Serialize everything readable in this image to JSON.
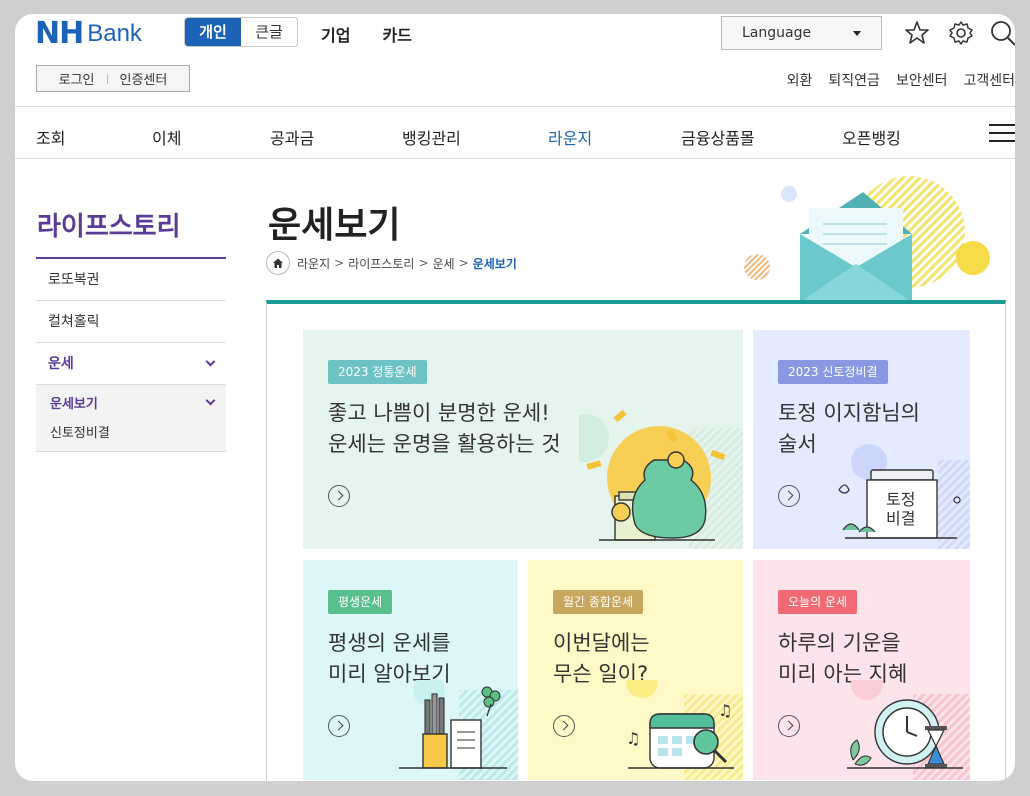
{
  "header": {
    "logo_primary": "NH",
    "logo_secondary": "Bank",
    "segments": [
      "개인",
      "큰글"
    ],
    "top_nav": [
      "기업",
      "카드"
    ],
    "language_label": "Language",
    "login": "로그인",
    "certificate": "인증센터",
    "utility_links": [
      "외환",
      "퇴직연금",
      "보안센터",
      "고객센터"
    ]
  },
  "gnb": [
    "조회",
    "이체",
    "공과금",
    "뱅킹관리",
    "라운지",
    "금융상품몰",
    "오픈뱅킹"
  ],
  "sidebar": {
    "title": "라이프스토리",
    "items": [
      "로또복권",
      "컬쳐홀릭",
      "운세"
    ],
    "sub_items": [
      "운세보기",
      "신토정비결"
    ]
  },
  "main": {
    "title": "운세보기",
    "breadcrumb": [
      "라운지",
      "라이프스토리",
      "운세",
      "운세보기"
    ]
  },
  "cards": [
    {
      "badge": "2023 정통운세",
      "text": "좋고 나쁨이 분명한 운세!\n운세는 운명을 활용하는 것",
      "bg": "#e6f4ee",
      "badge_color": "#6dc2c4"
    },
    {
      "badge": "2023 신토정비결",
      "text": "토정 이지함님의\n술서",
      "bg": "#e5ebff",
      "badge_color": "#8a98e2",
      "book": [
        "토정",
        "비결"
      ]
    },
    {
      "badge": "평생운세",
      "text": "평생의 운세를\n미리 알아보기",
      "bg": "#ddf7f8",
      "badge_color": "#57c08d"
    },
    {
      "badge": "월간 종합운세",
      "text": "이번달에는\n무슨 일이?",
      "bg": "#fff9c7",
      "badge_color": "#c9a65e"
    },
    {
      "badge": "오늘의 운세",
      "text": "하루의 기운을\n미리 아는 지혜",
      "bg": "#fde3ea",
      "badge_color": "#ef6a73"
    }
  ],
  "colors": {
    "brand": "#1c63b8",
    "accent_purple": "#5b3c99",
    "accent_teal": "#1d9a96"
  }
}
